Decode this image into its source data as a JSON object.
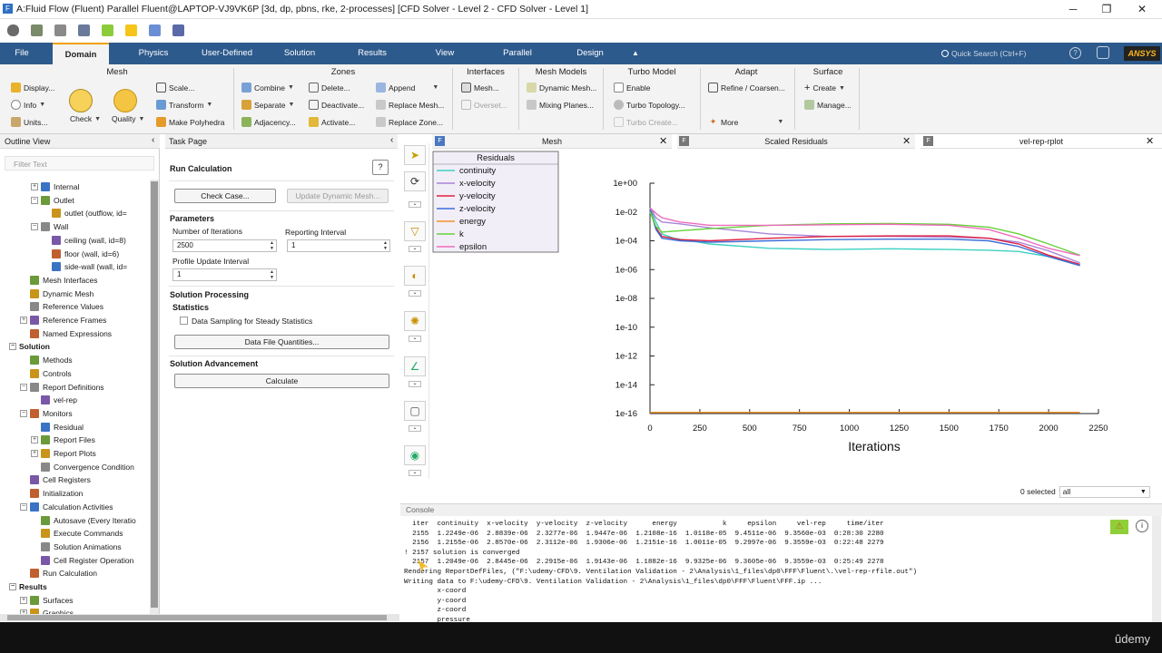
{
  "window": {
    "title": "A:Fluid Flow (Fluent) Parallel Fluent@LAPTOP-VJ9VK6P  [3d, dp, pbns, rke, 2-processes] [CFD Solver - Level 2 - CFD Solver - Level 1]",
    "minimize": "─",
    "maximize": "❐",
    "close": "✕"
  },
  "ribbon_tabs": [
    "File",
    "Domain",
    "Physics",
    "User-Defined",
    "Solution",
    "Results",
    "View",
    "Parallel",
    "Design"
  ],
  "ribbon_collapse": "▲",
  "quick_search": "Quick Search (Ctrl+F)",
  "ansys": "ANSYS",
  "ribbon": {
    "mesh": {
      "title": "Mesh",
      "display": "Display...",
      "info": "Info",
      "units": "Units...",
      "check": "Check",
      "quality": "Quality",
      "scale": "Scale...",
      "transform": "Transform",
      "make_polyhedra": "Make Polyhedra"
    },
    "zones": {
      "title": "Zones",
      "combine": "Combine",
      "separate": "Separate",
      "adjacency": "Adjacency...",
      "delete": "Delete...",
      "deactivate": "Deactivate...",
      "activate": "Activate...",
      "append": "Append",
      "replace_mesh": "Replace Mesh...",
      "replace_zone": "Replace Zone..."
    },
    "interfaces": {
      "title": "Interfaces",
      "mesh": "Mesh...",
      "overset": "Overset..."
    },
    "mesh_models": {
      "title": "Mesh Models",
      "dynamic_mesh": "Dynamic Mesh...",
      "mixing_planes": "Mixing Planes..."
    },
    "turbo_model": {
      "title": "Turbo Model",
      "enable": "Enable",
      "turbo_topology": "Turbo Topology...",
      "turbo_create": "Turbo Create..."
    },
    "adapt": {
      "title": "Adapt",
      "refine": "Refine / Coarsen...",
      "more": "More"
    },
    "surface": {
      "title": "Surface",
      "create": "Create",
      "manage": "Manage..."
    }
  },
  "outline": {
    "title": "Outline View",
    "filter_placeholder": "Filter Text",
    "items": [
      {
        "label": "Internal",
        "level": 2,
        "exp": "+"
      },
      {
        "label": "Outlet",
        "level": 2,
        "exp": "−"
      },
      {
        "label": "outlet (outflow, id=",
        "level": 3,
        "exp": ""
      },
      {
        "label": "Wall",
        "level": 2,
        "exp": "−"
      },
      {
        "label": "ceiling (wall, id=8)",
        "level": 3,
        "exp": ""
      },
      {
        "label": "floor (wall, id=6)",
        "level": 3,
        "exp": ""
      },
      {
        "label": "side-wall (wall, id=",
        "level": 3,
        "exp": ""
      },
      {
        "label": "Mesh Interfaces",
        "level": 1,
        "exp": ""
      },
      {
        "label": "Dynamic Mesh",
        "level": 1,
        "exp": ""
      },
      {
        "label": "Reference Values",
        "level": 1,
        "exp": ""
      },
      {
        "label": "Reference Frames",
        "level": 1,
        "exp": "+"
      },
      {
        "label": "Named Expressions",
        "level": 1,
        "exp": ""
      },
      {
        "label": "Solution",
        "level": 0,
        "exp": "−",
        "bold": true
      },
      {
        "label": "Methods",
        "level": 1,
        "exp": ""
      },
      {
        "label": "Controls",
        "level": 1,
        "exp": ""
      },
      {
        "label": "Report Definitions",
        "level": 1,
        "exp": "−"
      },
      {
        "label": "vel-rep",
        "level": 2,
        "exp": ""
      },
      {
        "label": "Monitors",
        "level": 1,
        "exp": "−"
      },
      {
        "label": "Residual",
        "level": 2,
        "exp": ""
      },
      {
        "label": "Report Files",
        "level": 2,
        "exp": "+"
      },
      {
        "label": "Report Plots",
        "level": 2,
        "exp": "+"
      },
      {
        "label": "Convergence Condition",
        "level": 2,
        "exp": ""
      },
      {
        "label": "Cell Registers",
        "level": 1,
        "exp": ""
      },
      {
        "label": "Initialization",
        "level": 1,
        "exp": ""
      },
      {
        "label": "Calculation Activities",
        "level": 1,
        "exp": "−"
      },
      {
        "label": "Autosave (Every Iteratio",
        "level": 2,
        "exp": ""
      },
      {
        "label": "Execute Commands",
        "level": 2,
        "exp": ""
      },
      {
        "label": "Solution Animations",
        "level": 2,
        "exp": ""
      },
      {
        "label": "Cell Register Operation",
        "level": 2,
        "exp": ""
      },
      {
        "label": "Run Calculation",
        "level": 1,
        "exp": ""
      },
      {
        "label": "Results",
        "level": 0,
        "exp": "−",
        "bold": true
      },
      {
        "label": "Surfaces",
        "level": 1,
        "exp": "+"
      },
      {
        "label": "Graphics",
        "level": 1,
        "exp": "+"
      },
      {
        "label": "Plots",
        "level": 1,
        "exp": ""
      }
    ]
  },
  "task": {
    "header": "Task Page",
    "title": "Run Calculation",
    "check_case": "Check Case...",
    "update_dynamic_mesh": "Update Dynamic Mesh...",
    "parameters": "Parameters",
    "num_iter_label": "Number of Iterations",
    "num_iter_value": "2500",
    "report_interval_label": "Reporting Interval",
    "report_interval_value": "1",
    "profile_label": "Profile Update Interval",
    "profile_value": "1",
    "solution_processing": "Solution Processing",
    "statistics": "Statistics",
    "data_sampling": "Data Sampling for Steady Statistics",
    "data_file_quantities": "Data File Quantities...",
    "solution_advancement": "Solution Advancement",
    "calculate": "Calculate"
  },
  "graphics_tabs": [
    {
      "label": "Mesh"
    },
    {
      "label": "Scaled Residuals"
    },
    {
      "label": "vel-rep-rplot"
    }
  ],
  "legend": {
    "title": "Residuals"
  },
  "chart_data": {
    "type": "line",
    "title": "",
    "xlabel": "Iterations",
    "ylabel": "",
    "y_scale": "log",
    "xlim": [
      0,
      2250
    ],
    "ylim": [
      1e-16,
      1
    ],
    "x_ticks": [
      "0",
      "250",
      "500",
      "750",
      "1000",
      "1250",
      "1500",
      "1750",
      "2000",
      "2250"
    ],
    "y_ticks": [
      "1e+00",
      "1e-02",
      "1e-04",
      "1e-06",
      "1e-08",
      "1e-10",
      "1e-12",
      "1e-14",
      "1e-16"
    ],
    "grid": false,
    "legend_position": "top-left",
    "series": [
      {
        "name": "continuity",
        "color": "#3ed1c2",
        "x": [
          0,
          30,
          60,
          120,
          300,
          600,
          900,
          1200,
          1500,
          1700,
          1850,
          2000,
          2157
        ],
        "y": [
          0.02,
          0.002,
          0.0003,
          0.00015,
          6e-05,
          3e-05,
          2.5e-05,
          2.8e-05,
          2.5e-05,
          2.2e-05,
          1.8e-05,
          8e-06,
          1.9e-06
        ]
      },
      {
        "name": "x-velocity",
        "color": "#a884d8",
        "x": [
          0,
          30,
          60,
          150,
          300,
          600,
          900,
          1200,
          1500,
          1700,
          1850,
          2000,
          2157
        ],
        "y": [
          0.02,
          0.004,
          0.002,
          0.0015,
          0.0008,
          0.0003,
          0.0002,
          0.0002,
          0.00018,
          0.00015,
          8e-05,
          2e-05,
          2.9e-06
        ]
      },
      {
        "name": "y-velocity",
        "color": "#e02040",
        "x": [
          0,
          30,
          60,
          150,
          300,
          600,
          900,
          1200,
          1500,
          1700,
          1850,
          2000,
          2157
        ],
        "y": [
          0.015,
          0.0008,
          0.0002,
          0.00012,
          0.0001,
          0.00015,
          0.0002,
          0.00022,
          0.00022,
          0.00015,
          6e-05,
          1e-05,
          2.3e-06
        ]
      },
      {
        "name": "z-velocity",
        "color": "#3b6fd8",
        "x": [
          0,
          30,
          60,
          150,
          300,
          600,
          900,
          1200,
          1500,
          1700,
          1850,
          2000,
          2157
        ],
        "y": [
          0.015,
          0.0006,
          0.00015,
          0.0001,
          8e-05,
          0.0001,
          0.00012,
          0.00013,
          0.00013,
          0.0001,
          4e-05,
          8e-06,
          1.9e-06
        ]
      },
      {
        "name": "energy",
        "color": "#f0922a",
        "x": [
          0,
          500,
          1000,
          1500,
          2157
        ],
        "y": [
          1.2e-16,
          1.2e-16,
          1.2e-16,
          1.2e-16,
          1.2e-16
        ]
      },
      {
        "name": "k",
        "color": "#66d13a",
        "x": [
          0,
          30,
          60,
          150,
          300,
          600,
          900,
          1200,
          1500,
          1700,
          1850,
          2000,
          2157
        ],
        "y": [
          0.01,
          0.001,
          0.0004,
          0.0005,
          0.0007,
          0.0012,
          0.0015,
          0.0016,
          0.0014,
          0.0009,
          0.0003,
          6e-05,
          1e-05
        ]
      },
      {
        "name": "epsilon",
        "color": "#f06bbd",
        "x": [
          0,
          30,
          60,
          150,
          300,
          600,
          900,
          1200,
          1500,
          1700,
          1850,
          2000,
          2157
        ],
        "y": [
          0.02,
          0.008,
          0.004,
          0.002,
          0.0012,
          0.0012,
          0.0013,
          0.0014,
          0.0012,
          0.0006,
          0.00015,
          3e-05,
          9.4e-06
        ]
      }
    ]
  },
  "selected": {
    "label": "0 selected",
    "value": "all"
  },
  "console": {
    "title": "Console",
    "lines": [
      "  iter  continuity  x-velocity  y-velocity  z-velocity      energy           k     epsilon     vel-rep     time/iter",
      "  2155  1.2249e-06  2.8839e-06  2.3277e-06  1.9447e-06  1.2108e-16  1.0118e-05  9.4511e-06  9.3560e-03  0:28:30 2280",
      "  2156  1.2155e-06  2.8570e-06  2.3112e-06  1.9306e-06  1.2151e-16  1.0011e-05  9.2997e-06  9.3559e-03  0:22:48 2279",
      "! 2157 solution is converged",
      "  2157  1.2049e-06  2.8445e-06  2.2915e-06  1.9143e-06  1.1882e-16  9.9325e-06  9.3605e-06  9.3559e-03  0:25:49 2278",
      "Rendering ReportDefFiles, (\"F:\\udemy-CFD\\9. Ventilation Validation - 2\\Analysis\\1_files\\dp0\\FFF\\Fluent\\.\\vel-rep-rfile.out\")",
      "Writing data to F:\\udemy-CFD\\9. Ventilation Validation - 2\\Analysis\\1_files\\dp0\\FFF\\Fluent\\FFF.ip ...",
      "        x-coord",
      "        y-coord",
      "        z-coord",
      "        pressure"
    ]
  },
  "watermark": "ûdemy"
}
